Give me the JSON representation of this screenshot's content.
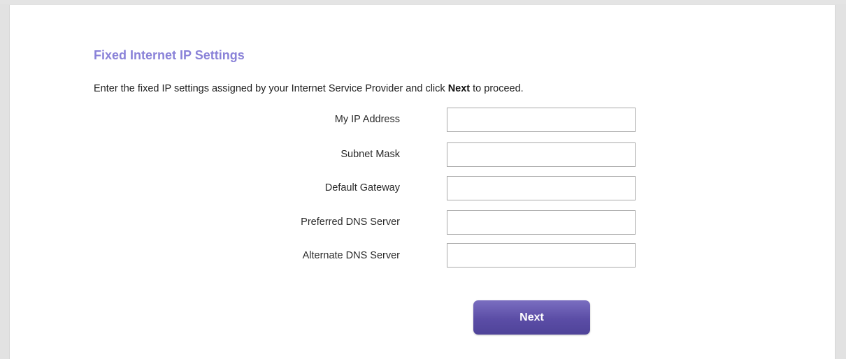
{
  "page": {
    "title": "Fixed Internet IP Settings",
    "instructions": {
      "prefix": "Enter the fixed IP settings assigned by your Internet Service Provider and click ",
      "emphasis": "Next",
      "suffix": " to proceed."
    }
  },
  "fields": [
    {
      "label": "My IP Address",
      "value": ""
    },
    {
      "label": "Subnet Mask",
      "value": ""
    },
    {
      "label": "Default Gateway",
      "value": ""
    },
    {
      "label": "Preferred DNS Server",
      "value": ""
    },
    {
      "label": "Alternate DNS Server",
      "value": ""
    }
  ],
  "actions": {
    "next_label": "Next"
  },
  "colors": {
    "title": "#8a82d8",
    "button": "#5b4da6",
    "button_text": "#ffffff"
  }
}
